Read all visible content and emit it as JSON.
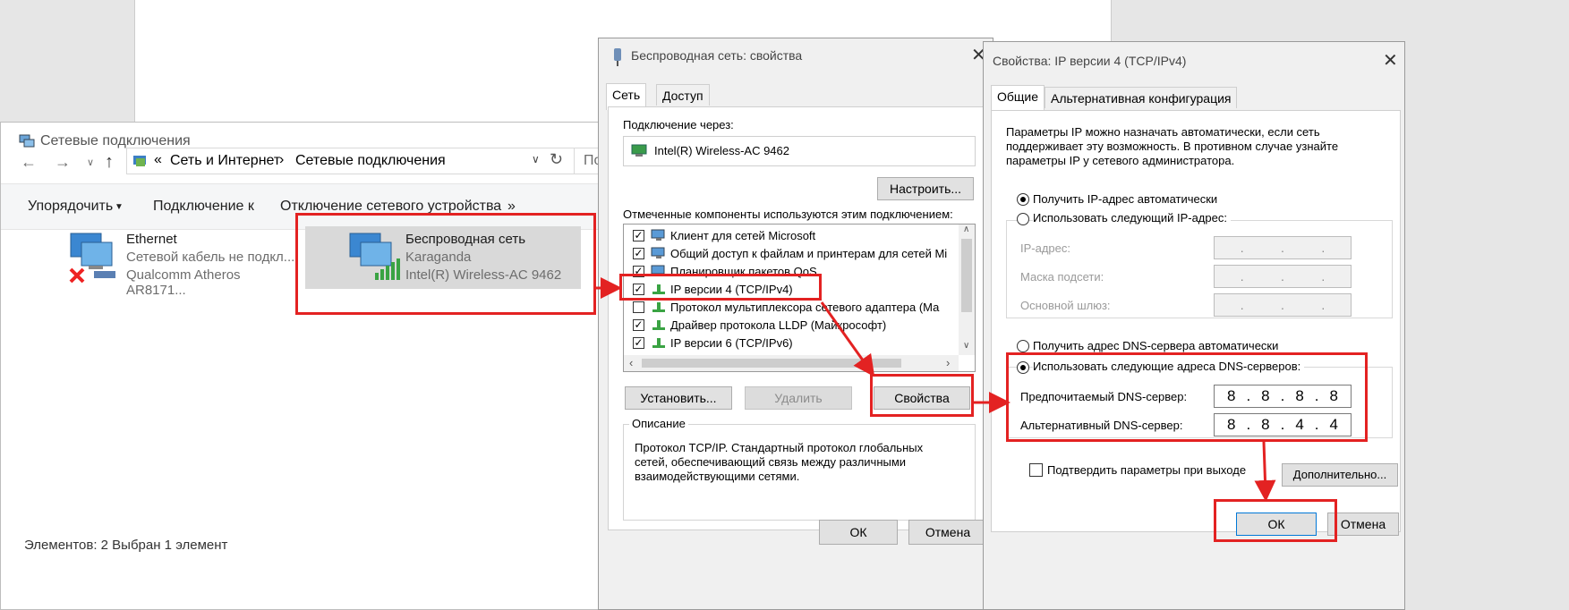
{
  "explorer": {
    "title": "Сетевые подключения",
    "breadcrumb_sep": "«",
    "crumb1": "Сеть и Интернет",
    "crumb_arrow": "›",
    "crumb2": "Сетевые подключения",
    "search_partial": "По",
    "toolbar": {
      "organize": "Упорядочить",
      "connect": "Подключение к",
      "disable": "Отключение сетевого устройства",
      "more": "»"
    },
    "adapters": [
      {
        "name": "Ethernet",
        "status": "Сетевой кабель не подкл...",
        "device": "Qualcomm Atheros AR8171..."
      },
      {
        "name": "Беспроводная сеть",
        "status": "Karaganda",
        "device": "Intel(R) Wireless-AC 9462"
      }
    ],
    "statusbar": "Элементов: 2     Выбран 1 элемент"
  },
  "props": {
    "title": "Беспроводная сеть: свойства",
    "tabs": [
      "Сеть",
      "Доступ"
    ],
    "connect_via": "Подключение через:",
    "adapter": "Intel(R) Wireless-AC 9462",
    "configure": "Настроить...",
    "components_label": "Отмеченные компоненты используются этим подключением:",
    "components": [
      {
        "label": "Клиент для сетей Microsoft",
        "checked": true
      },
      {
        "label": "Общий доступ к файлам и принтерам для сетей Mi",
        "checked": true
      },
      {
        "label": "Планировщик пакетов QoS",
        "checked": true
      },
      {
        "label": "IP версии 4 (TCP/IPv4)",
        "checked": true
      },
      {
        "label": "Протокол мультиплексора сетевого адаптера (Ма",
        "checked": false
      },
      {
        "label": "Драйвер протокола LLDP (Майкрософт)",
        "checked": true
      },
      {
        "label": "IP версии 6 (TCP/IPv6)",
        "checked": true
      }
    ],
    "install": "Установить...",
    "remove": "Удалить",
    "properties": "Свойства",
    "description_label": "Описание",
    "description": "Протокол TCP/IP. Стандартный протокол глобальных сетей, обеспечивающий связь между различными взаимодействующими сетями.",
    "ok": "ОК",
    "cancel": "Отмена"
  },
  "ipv4": {
    "title": "Свойства: IP версии 4 (TCP/IPv4)",
    "tabs": [
      "Общие",
      "Альтернативная конфигурация"
    ],
    "intro": "Параметры IP можно назначать автоматически, если сеть поддерживает эту возможность. В противном случае узнайте параметры IP у сетевого администратора.",
    "auto_ip": "Получить IP-адрес автоматически",
    "manual_ip": "Использовать следующий IP-адрес:",
    "ip_label": "IP-адрес:",
    "mask_label": "Маска подсети:",
    "gateway_label": "Основной шлюз:",
    "auto_dns": "Получить адрес DNS-сервера автоматически",
    "manual_dns": "Использовать следующие адреса DNS-серверов:",
    "preferred_label": "Предпочитаемый DNS-сервер:",
    "preferred": [
      "8",
      "8",
      "8",
      "8"
    ],
    "alternate_label": "Альтернативный DNS-сервер:",
    "alternate": [
      "8",
      "8",
      "4",
      "4"
    ],
    "validate": "Подтвердить параметры при выходе",
    "advanced": "Дополнительно...",
    "ok": "ОК",
    "cancel": "Отмена"
  },
  "colors": {
    "highlight": "#e32222",
    "selection": "#d9d9d9",
    "accent": "#0078d7"
  }
}
